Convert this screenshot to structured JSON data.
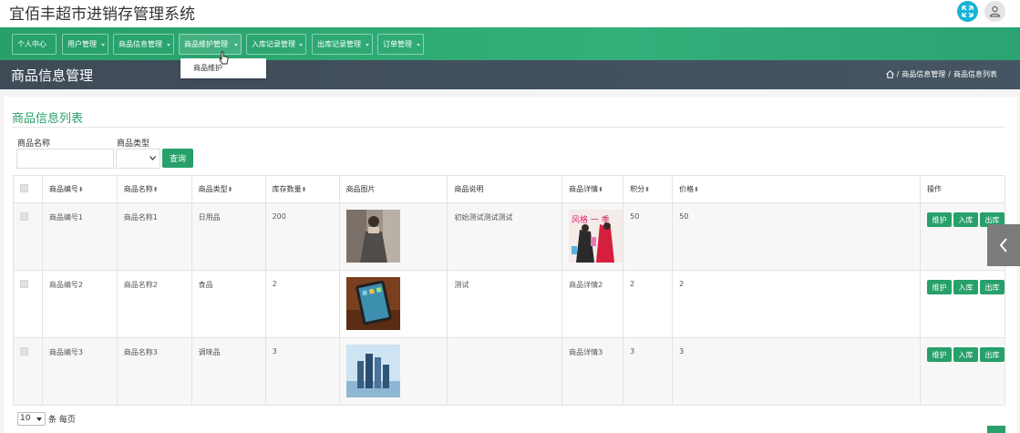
{
  "app": {
    "title": "宜佰丰超市进销存管理系统"
  },
  "nav": {
    "items": [
      {
        "label": "个人中心"
      },
      {
        "label": "用户管理"
      },
      {
        "label": "商品信息管理"
      },
      {
        "label": "商品维护管理"
      },
      {
        "label": "入库记录管理"
      },
      {
        "label": "出库记录管理"
      },
      {
        "label": "订单管理"
      }
    ],
    "dropdown_item": "商品维护"
  },
  "header": {
    "title": "商品信息管理",
    "breadcrumb": [
      "商品信息管理",
      "商品信息列表"
    ],
    "breadcrumb_sep": "/"
  },
  "list": {
    "title": "商品信息列表",
    "filters": {
      "name_label": "商品名称",
      "type_label": "商品类型",
      "query_button": "查询"
    },
    "columns": [
      "商品编号",
      "商品名称",
      "商品类型",
      "库存数量",
      "商品图片",
      "商品说明",
      "商品详情",
      "积分",
      "价格",
      "操作"
    ],
    "rows": [
      {
        "code": "商品编号1",
        "name": "商品名称1",
        "type": "日用品",
        "stock": "200",
        "image": "dress-photo",
        "desc": "初始测试测试测试",
        "detail": "poster-image",
        "points": "50",
        "price": "50"
      },
      {
        "code": "商品编号2",
        "name": "商品名称2",
        "type": "食品",
        "stock": "2",
        "image": "tablet-photo",
        "desc": "测试",
        "detail": "商品详情2",
        "points": "2",
        "price": "2"
      },
      {
        "code": "商品编号3",
        "name": "商品名称3",
        "type": "调味品",
        "stock": "3",
        "image": "cosmetics-photo",
        "desc": "",
        "detail": "商品详情3",
        "points": "3",
        "price": "3"
      }
    ],
    "actions": {
      "maintain": "维护",
      "stock_in": "入库",
      "stock_out": "出库"
    }
  },
  "pager": {
    "page_size": "10",
    "suffix": "条 每页"
  },
  "colors": {
    "accent": "#27a06a",
    "header_band": "#3f4b57",
    "expand": "#17b3d6"
  }
}
